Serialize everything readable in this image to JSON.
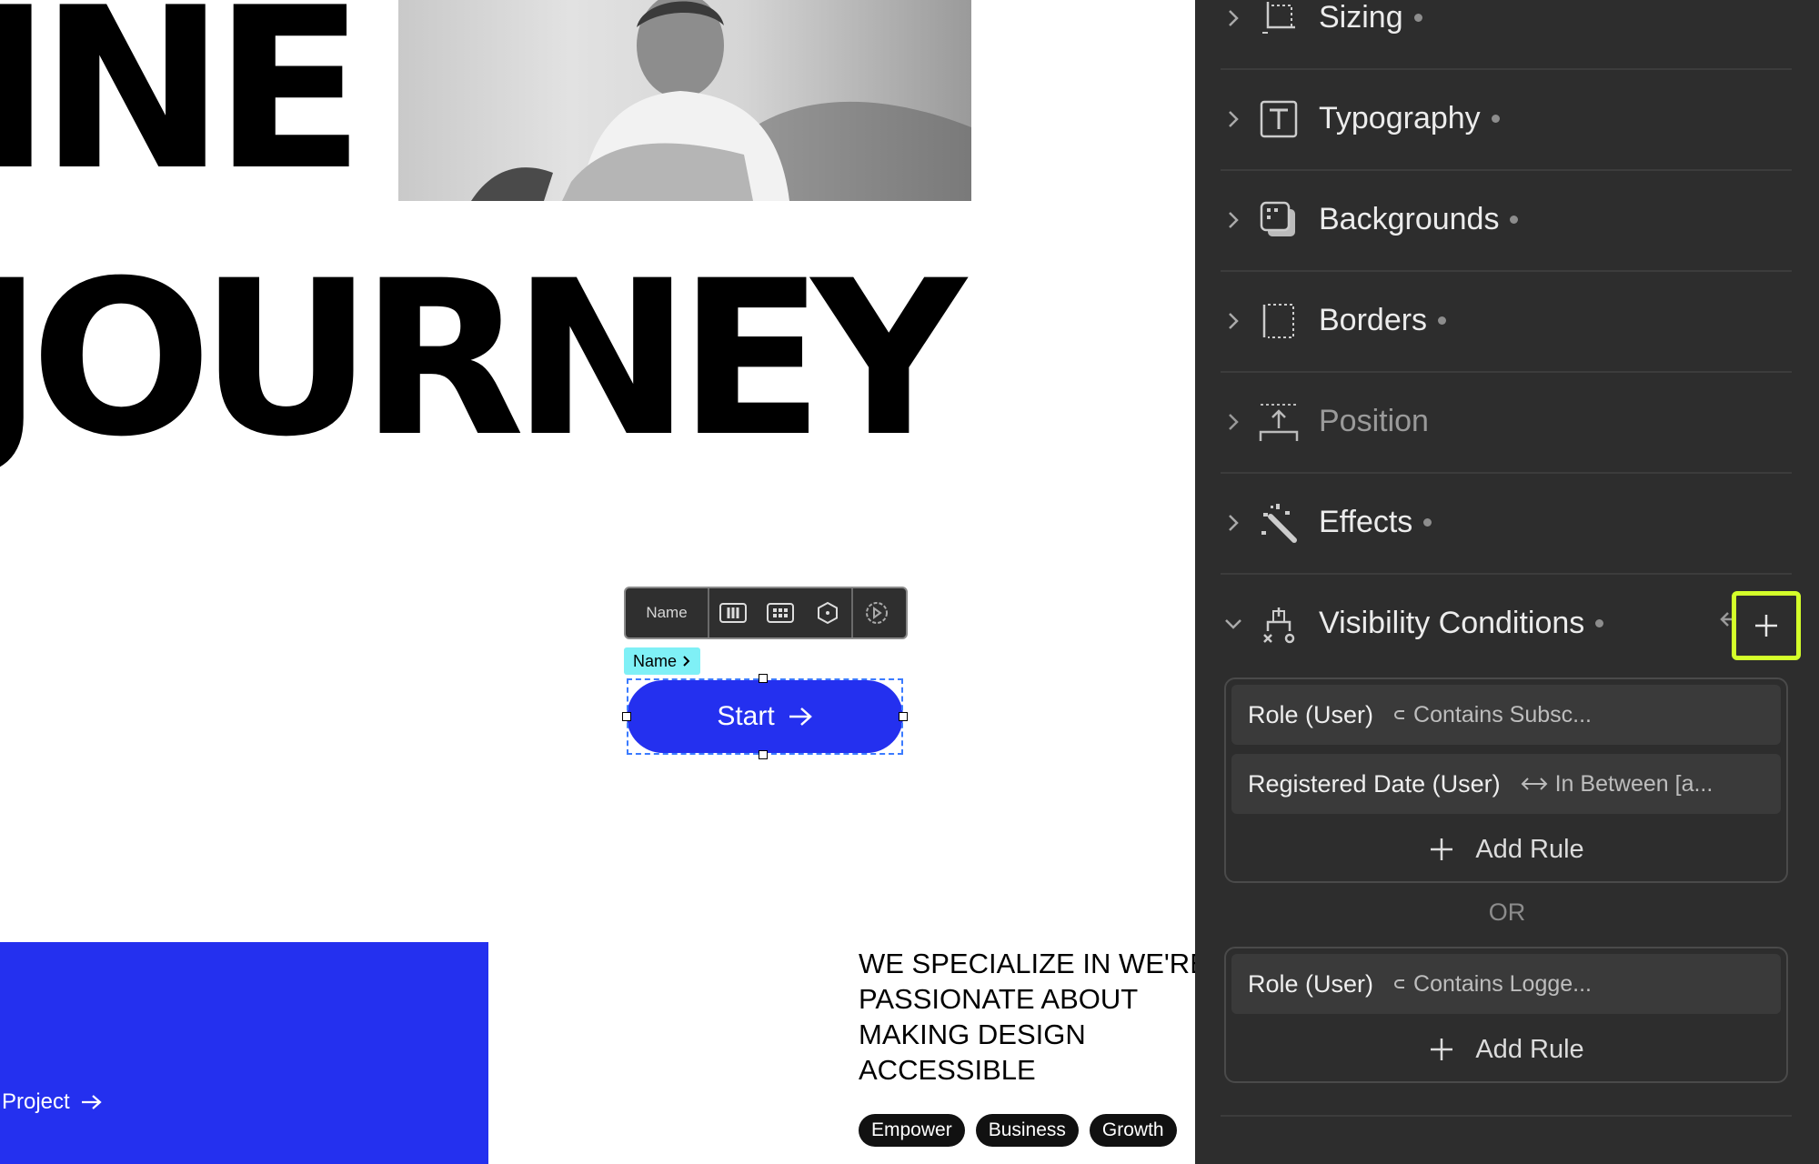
{
  "canvas": {
    "hero_line1": "INE",
    "hero_line2": "JOURNEY",
    "toolbar": {
      "name_label": "Name"
    },
    "name_tag": "Name",
    "start_button": "Start",
    "project_link": "Project",
    "specialize_text": "WE SPECIALIZE IN WE'RE PASSIONATE ABOUT MAKING DESIGN ACCESSIBLE",
    "tags": [
      "Empower",
      "Business",
      "Growth"
    ],
    "accent_color": "#2430ef"
  },
  "panel": {
    "sections": [
      {
        "label": "Sizing",
        "icon": "sizing-icon"
      },
      {
        "label": "Typography",
        "icon": "typography-icon"
      },
      {
        "label": "Backgrounds",
        "icon": "backgrounds-icon"
      },
      {
        "label": "Borders",
        "icon": "borders-icon"
      },
      {
        "label": "Position",
        "icon": "position-icon"
      },
      {
        "label": "Effects",
        "icon": "effects-icon"
      }
    ],
    "visibility": {
      "title": "Visibility Conditions",
      "groups": [
        {
          "rules": [
            {
              "field": "Role (User)",
              "op": "Contains Subsc...",
              "op_icon": "contains-icon"
            },
            {
              "field": "Registered Date (User)",
              "op": "In Between [a...",
              "op_icon": "between-icon"
            }
          ],
          "add_label": "Add Rule"
        },
        {
          "rules": [
            {
              "field": "Role (User)",
              "op": "Contains Logge...",
              "op_icon": "contains-icon"
            }
          ],
          "add_label": "Add Rule"
        }
      ],
      "or_label": "OR",
      "highlight_color": "#d4ff2a"
    }
  }
}
